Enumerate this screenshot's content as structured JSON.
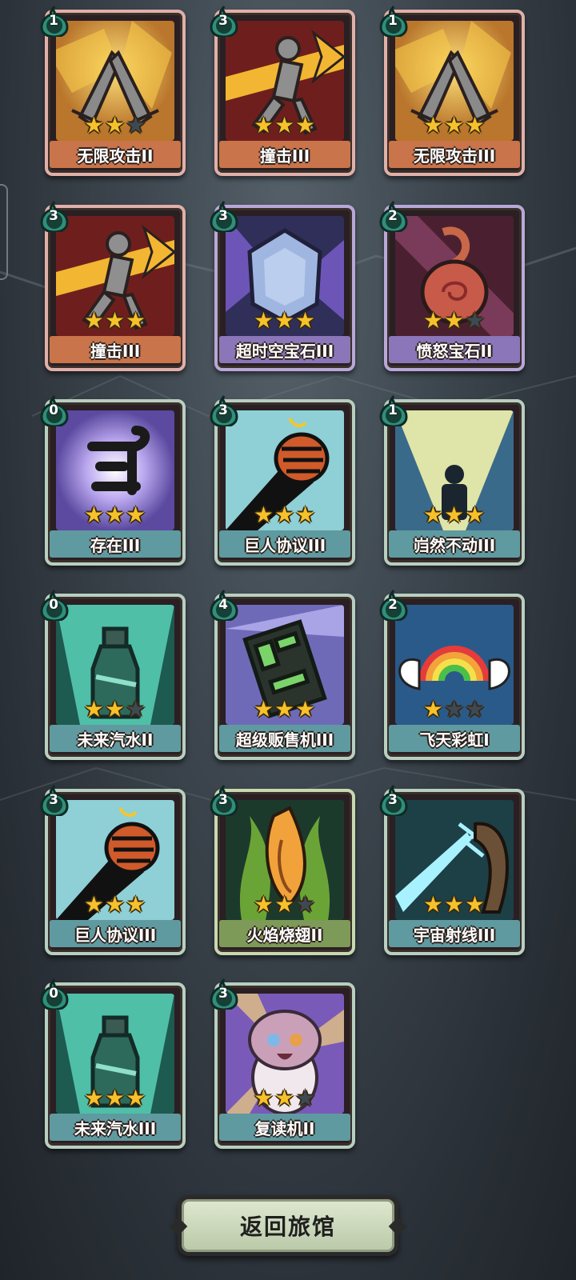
{
  "cards": [
    {
      "name": "无限攻击II",
      "cost": "1",
      "stars": 2,
      "max_stars": 3,
      "theme": "attack",
      "icon": "crossed-swords-icon"
    },
    {
      "name": "撞击III",
      "cost": "3",
      "stars": 3,
      "max_stars": 3,
      "theme": "attack",
      "icon": "dash-figure-icon"
    },
    {
      "name": "无限攻击III",
      "cost": "1",
      "stars": 3,
      "max_stars": 3,
      "theme": "attack",
      "icon": "crossed-swords-icon"
    },
    {
      "name": "撞击III",
      "cost": "3",
      "stars": 3,
      "max_stars": 3,
      "theme": "attack",
      "icon": "dash-figure-icon"
    },
    {
      "name": "超时空宝石III",
      "cost": "3",
      "stars": 3,
      "max_stars": 3,
      "theme": "gem",
      "icon": "crystal-gem-icon"
    },
    {
      "name": "愤怒宝石II",
      "cost": "2",
      "stars": 2,
      "max_stars": 3,
      "theme": "gem",
      "icon": "rage-gem-icon"
    },
    {
      "name": "存在III",
      "cost": "0",
      "stars": 3,
      "max_stars": 3,
      "theme": "skill",
      "icon": "rune-icon"
    },
    {
      "name": "巨人协议III",
      "cost": "3",
      "stars": 3,
      "max_stars": 3,
      "theme": "skill",
      "icon": "fist-icon"
    },
    {
      "name": "岿然不动III",
      "cost": "1",
      "stars": 3,
      "max_stars": 3,
      "theme": "skill",
      "icon": "stand-still-icon"
    },
    {
      "name": "未来汽水II",
      "cost": "0",
      "stars": 2,
      "max_stars": 3,
      "theme": "skill",
      "icon": "soda-bottle-icon"
    },
    {
      "name": "超级贩售机III",
      "cost": "4",
      "stars": 3,
      "max_stars": 3,
      "theme": "skill",
      "icon": "vending-machine-icon"
    },
    {
      "name": "飞天彩虹I",
      "cost": "2",
      "stars": 1,
      "max_stars": 3,
      "theme": "skill",
      "icon": "winged-rainbow-icon"
    },
    {
      "name": "巨人协议III",
      "cost": "3",
      "stars": 3,
      "max_stars": 3,
      "theme": "skill",
      "icon": "fist-icon"
    },
    {
      "name": "火焰烧翅II",
      "cost": "3",
      "stars": 2,
      "max_stars": 3,
      "theme": "green",
      "icon": "flame-wing-icon"
    },
    {
      "name": "宇宙射线III",
      "cost": "3",
      "stars": 3,
      "max_stars": 3,
      "theme": "skill",
      "icon": "cosmic-ray-icon"
    },
    {
      "name": "未来汽水III",
      "cost": "0",
      "stars": 3,
      "max_stars": 3,
      "theme": "skill",
      "icon": "soda-bottle-icon"
    },
    {
      "name": "复读机II",
      "cost": "3",
      "stars": 2,
      "max_stars": 3,
      "theme": "skill",
      "icon": "cat-creature-icon"
    }
  ],
  "footer": {
    "return_label": "返回旅馆"
  },
  "colors": {
    "star_on": "#f6c12a",
    "star_off": "#3d4a55",
    "attack": "#c9744a",
    "gem": "#8a76b8",
    "skill": "#5f9aa0",
    "green": "#7d9a58"
  }
}
